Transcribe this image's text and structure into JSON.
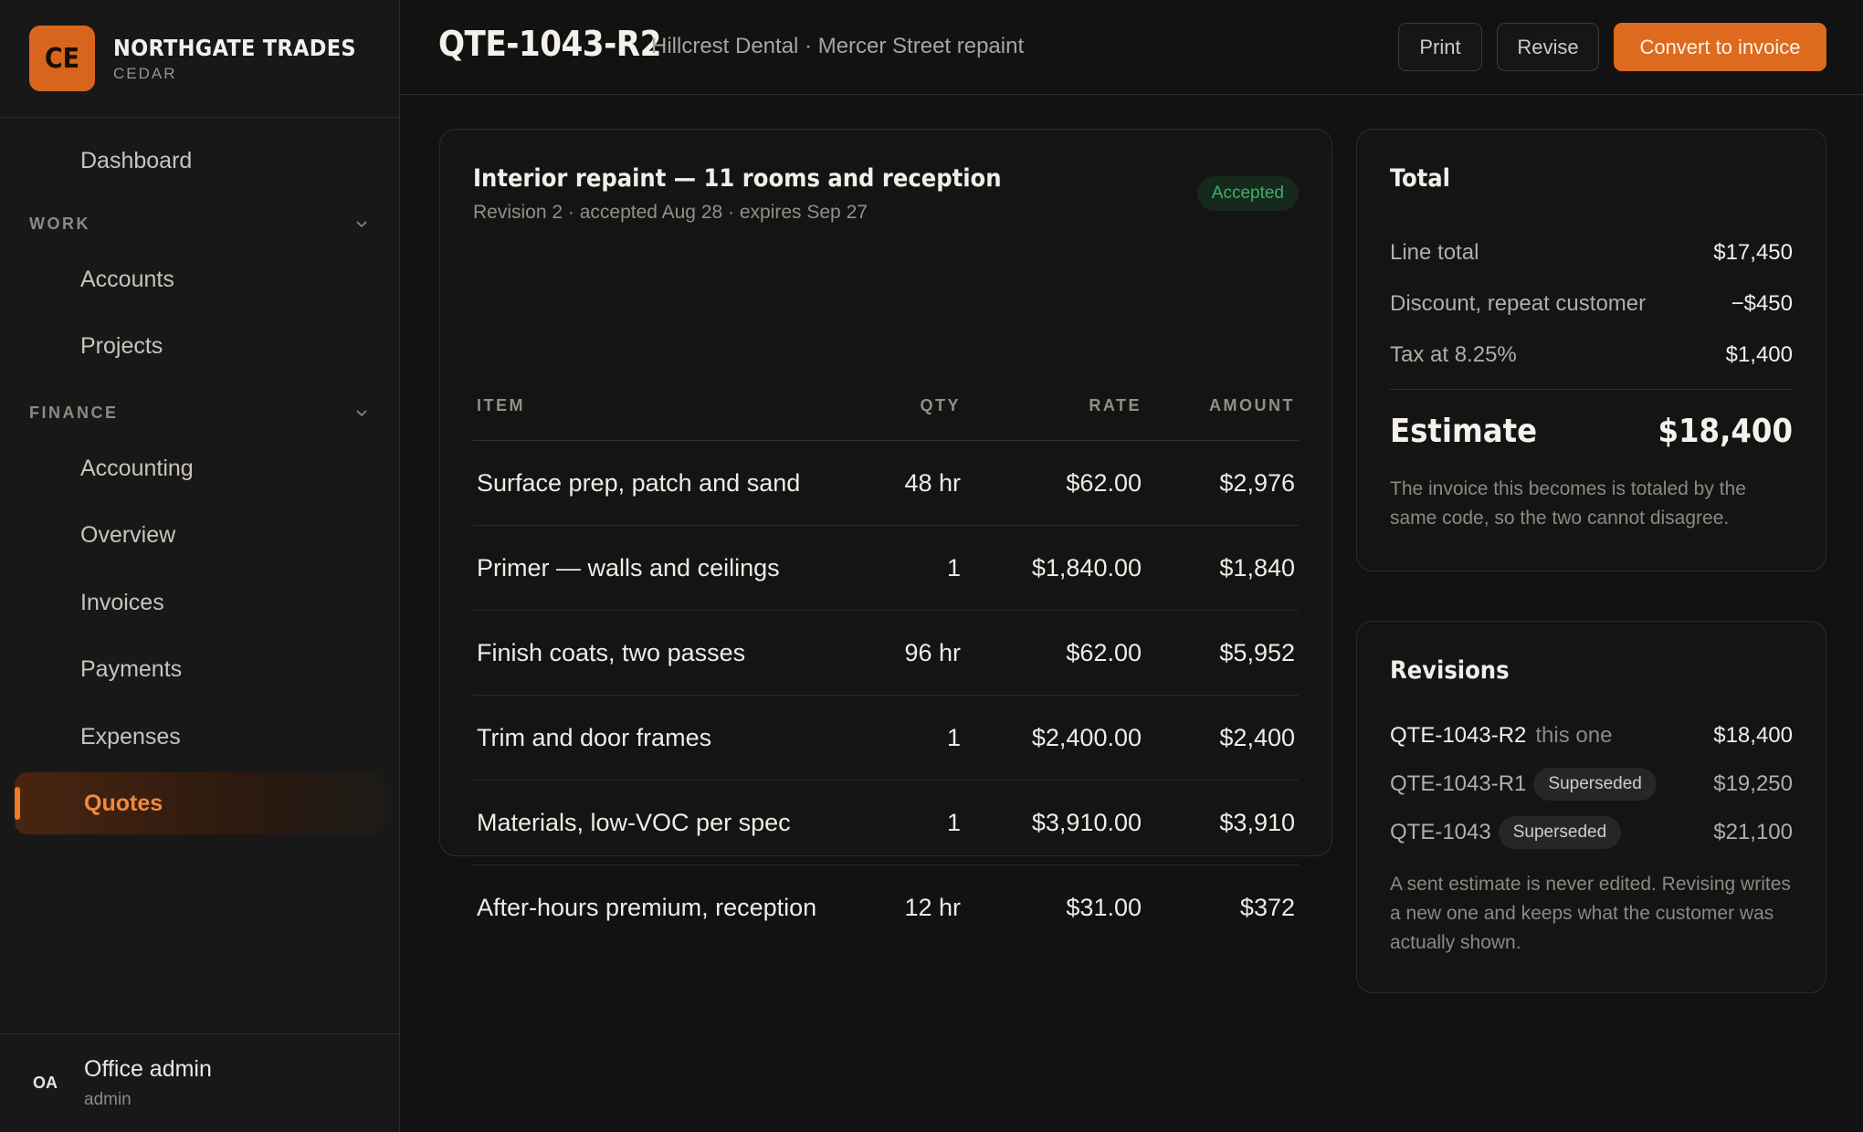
{
  "brand": {
    "logo": "CE",
    "name": "NORTHGATE TRADES",
    "sub": "CEDAR"
  },
  "nav": {
    "dashboard": "Dashboard",
    "work_label": "WORK",
    "work_items": [
      "Accounts",
      "Projects"
    ],
    "finance_label": "FINANCE",
    "finance_items": [
      "Accounting",
      "Overview",
      "Invoices",
      "Payments",
      "Expenses",
      "Quotes"
    ],
    "active": "Quotes"
  },
  "user": {
    "initials": "OA",
    "name": "Office admin",
    "role": "admin"
  },
  "header": {
    "title": "QTE-1043-R2",
    "subtitle": "Hillcrest Dental · Mercer Street repaint",
    "print": "Print",
    "revise": "Revise",
    "convert": "Convert to invoice"
  },
  "quote": {
    "title": "Interior repaint — 11 rooms and reception",
    "meta": "Revision 2 · accepted Aug 28 · expires Sep 27",
    "status": "Accepted",
    "columns": {
      "item": "ITEM",
      "qty": "QTY",
      "rate": "RATE",
      "amount": "AMOUNT"
    },
    "lines": [
      {
        "item": "Surface prep, patch and sand",
        "qty": "48 hr",
        "rate": "$62.00",
        "amount": "$2,976"
      },
      {
        "item": "Primer — walls and ceilings",
        "qty": "1",
        "rate": "$1,840.00",
        "amount": "$1,840"
      },
      {
        "item": "Finish coats, two passes",
        "qty": "96 hr",
        "rate": "$62.00",
        "amount": "$5,952"
      },
      {
        "item": "Trim and door frames",
        "qty": "1",
        "rate": "$2,400.00",
        "amount": "$2,400"
      },
      {
        "item": "Materials, low-VOC per spec",
        "qty": "1",
        "rate": "$3,910.00",
        "amount": "$3,910"
      },
      {
        "item": "After-hours premium, reception",
        "qty": "12 hr",
        "rate": "$31.00",
        "amount": "$372"
      }
    ]
  },
  "totals": {
    "title": "Total",
    "line_total_label": "Line total",
    "line_total": "$17,450",
    "discount_label": "Discount, repeat customer",
    "discount": "−$450",
    "tax_label": "Tax at 8.25%",
    "tax": "$1,400",
    "estimate_label": "Estimate",
    "estimate": "$18,400",
    "note": "The invoice this becomes is totaled by the same code, so the two cannot disagree."
  },
  "revisions": {
    "title": "Revisions",
    "items": [
      {
        "id": "QTE-1043-R2",
        "tag": "this one",
        "amount": "$18,400"
      },
      {
        "id": "QTE-1043-R1",
        "pill": "Superseded",
        "amount": "$19,250"
      },
      {
        "id": "QTE-1043",
        "pill": "Superseded",
        "amount": "$21,100"
      }
    ],
    "note": "A sent estimate is never edited. Revising writes a new one and keeps what the customer was actually shown."
  },
  "colors": {
    "accent": "#dd6a1f",
    "accepted": "#3fae6a",
    "background": "#121212"
  }
}
